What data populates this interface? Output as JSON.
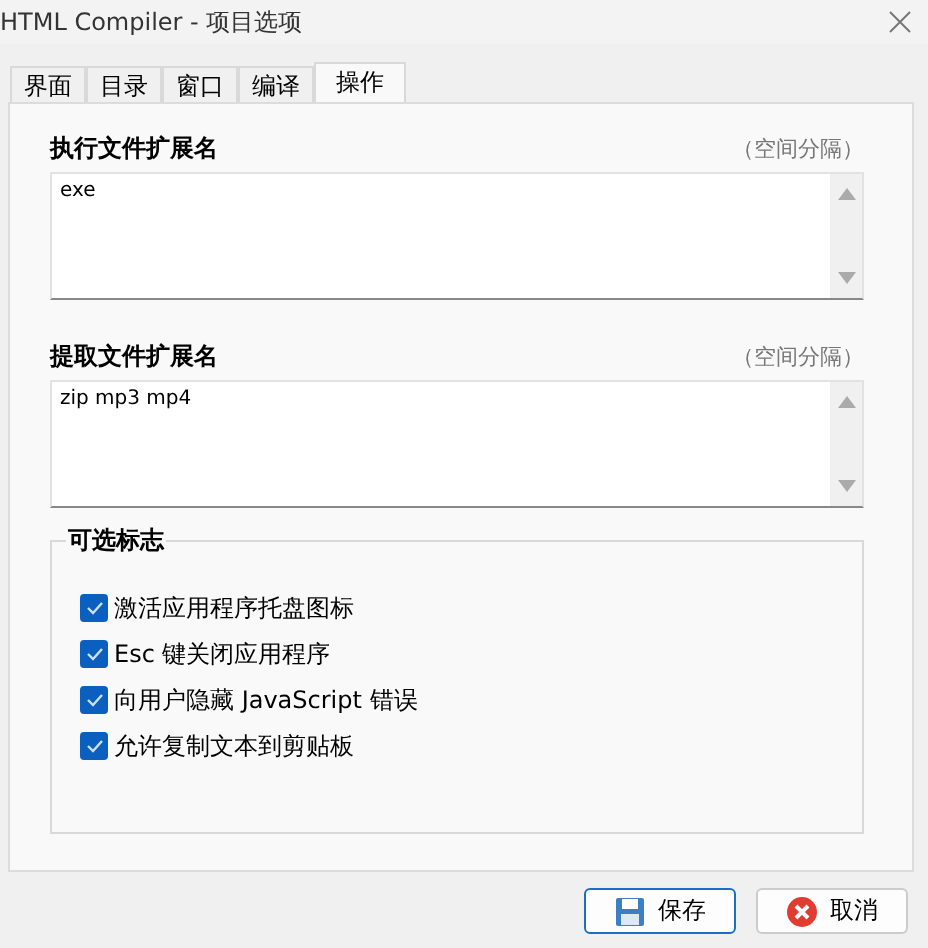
{
  "window": {
    "title": "HTML Compiler - 项目选项"
  },
  "tabs": [
    {
      "label": "界面",
      "selected": false
    },
    {
      "label": "目录",
      "selected": false
    },
    {
      "label": "窗口",
      "selected": false
    },
    {
      "label": "编译",
      "selected": false
    },
    {
      "label": "操作",
      "selected": true
    }
  ],
  "fields": [
    {
      "label": "执行文件扩展名",
      "hint": "（空间分隔）",
      "value": "exe"
    },
    {
      "label": "提取文件扩展名",
      "hint": "（空间分隔）",
      "value": "zip mp3 mp4"
    }
  ],
  "options_group": {
    "title": "可选标志",
    "options": [
      {
        "label": "激活应用程序托盘图标",
        "checked": true
      },
      {
        "label": "Esc 键关闭应用程序",
        "checked": true
      },
      {
        "label": "向用户隐藏 JavaScript 错误",
        "checked": true
      },
      {
        "label": "允许复制文本到剪贴板",
        "checked": true
      }
    ]
  },
  "buttons": [
    {
      "label": "保存",
      "kind": "save"
    },
    {
      "label": "取消",
      "kind": "cancel"
    }
  ]
}
